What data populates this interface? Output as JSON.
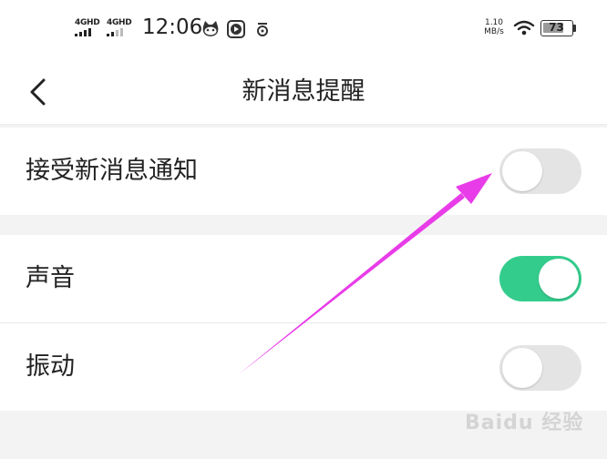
{
  "status_bar": {
    "signal_1": "4GHD",
    "signal_2": "4GHD",
    "time": "12:06",
    "net_speed_value": "1.10",
    "net_speed_unit": "MB/s",
    "battery": "73"
  },
  "header": {
    "back_icon": "chevron-left-icon",
    "title": "新消息提醒"
  },
  "settings": [
    {
      "label": "接受新消息通知",
      "enabled": false
    },
    {
      "label": "声音",
      "enabled": true
    },
    {
      "label": "振动",
      "enabled": false
    }
  ],
  "colors": {
    "toggle_on": "#33cc8c",
    "toggle_off": "#e4e4e4",
    "annotation_arrow": "#e83ce8"
  },
  "watermark": "Baidu 经验"
}
